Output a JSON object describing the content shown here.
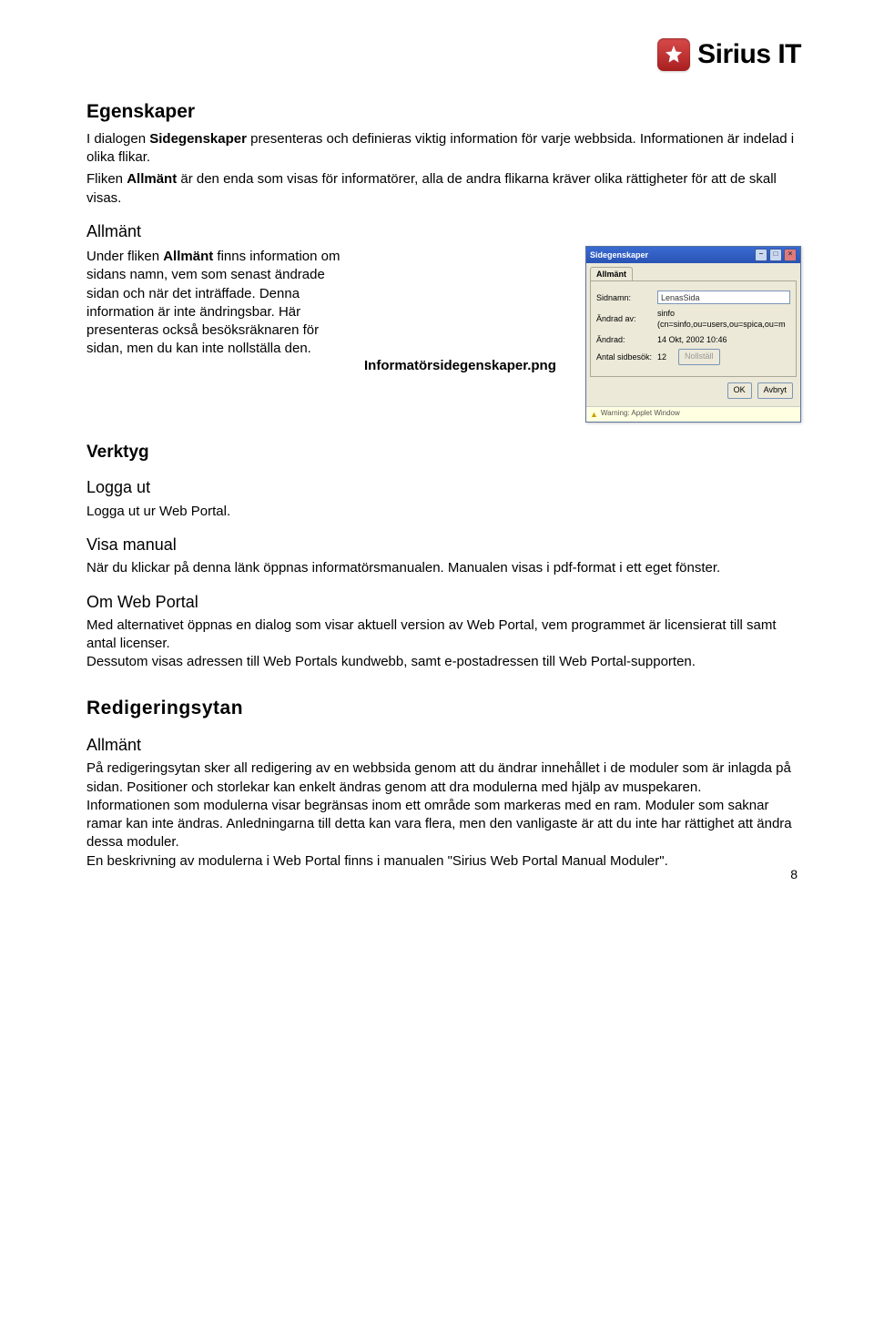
{
  "logo": {
    "text": "Sirius IT"
  },
  "h_egenskaper": "Egenskaper",
  "p_egenskaper_1a": "I dialogen ",
  "p_egenskaper_1b": "Sidegenskaper",
  "p_egenskaper_1c": " presenteras och definieras viktig information för varje webbsida. Informationen är indelad i olika flikar.",
  "p_egenskaper_2a": "Fliken ",
  "p_egenskaper_2b": "Allmänt",
  "p_egenskaper_2c": " är den enda som visas för informatörer, alla de andra flikarna kräver olika rättigheter för att de skall visas.",
  "h_allmant1": "Allmänt",
  "p_allmant_a": "Under fliken ",
  "p_allmant_b": "Allmänt",
  "p_allmant_c": " finns information om sidans namn, vem som senast ändrade sidan och när det inträffade. Denna information är inte ändringsbar. Här presenteras också besöksräknaren för sidan, men du kan inte nollställa den.",
  "figcap": "Informatörsidegenskaper.png",
  "h_verktyg": "Verktyg",
  "h_loggaut": "Logga ut",
  "p_loggaut": "Logga ut ur Web Portal.",
  "h_visa": "Visa manual",
  "p_visa": "När du klickar på denna länk öppnas informatörsmanualen. Manualen visas i pdf-format i ett eget fönster.",
  "h_om": "Om Web Portal",
  "p_om": "Med alternativet öppnas en dialog som visar aktuell version av Web Portal, vem programmet är licensierat till samt antal licenser.\nDessutom visas adressen till Web Portals kundwebb, samt e-postadressen till Web Portal-supporten.",
  "h_red": "Redigeringsytan",
  "h_allmant2": "Allmänt",
  "p_red": "På redigeringsytan sker all redigering av en webbsida genom att du ändrar innehållet i de moduler som är inlagda på sidan. Positioner och storlekar kan enkelt ändras genom att dra modulerna med hjälp av muspekaren.\nInformationen som modulerna visar begränsas inom ett område som markeras med en ram. Moduler som saknar ramar kan inte ändras. Anledningarna till detta kan vara flera, men den vanligaste är att du inte har rättighet att ändra dessa moduler.\nEn beskrivning av modulerna i Web Portal finns i manualen \"Sirius Web Portal Manual Moduler\".",
  "win": {
    "title": "Sidegenskaper",
    "tab": "Allmänt",
    "labels": {
      "sidnamn": "Sidnamn:",
      "andradav": "Ändrad av:",
      "andrad": "Ändrad:",
      "antal": "Antal sidbesök:"
    },
    "values": {
      "sidnamn": "LenasSida",
      "andradav": "sinfo (cn=sinfo,ou=users,ou=spica,ou=m",
      "andrad": "14 Okt, 2002 10:46",
      "antal": "12"
    },
    "buttons": {
      "nollstall": "Nollställ",
      "ok": "OK",
      "avbryt": "Avbryt"
    },
    "warning": "Warning: Applet Window"
  },
  "page_number": "8"
}
